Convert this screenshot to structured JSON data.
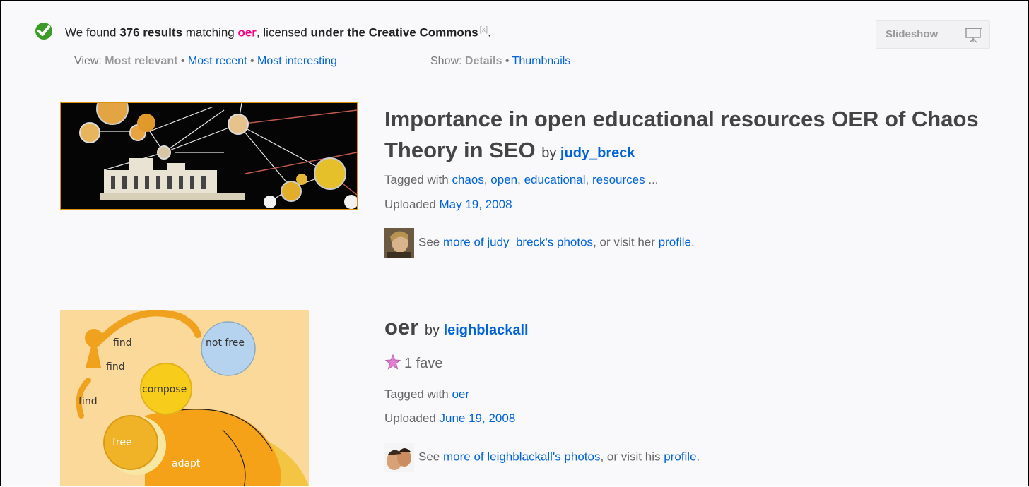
{
  "header": {
    "found_prefix": "We found ",
    "found_count": "376 results",
    "found_mid": " matching ",
    "query": "oer",
    "found_mid2": ", licensed ",
    "license": "under the Creative Commons",
    "close_mark": "[x]",
    "found_end": ".",
    "slideshow_label": "Slideshow"
  },
  "view": {
    "label": "View: ",
    "current": "Most relevant",
    "sep": " • ",
    "options": [
      "Most recent",
      "Most interesting"
    ]
  },
  "show": {
    "label": "Show: ",
    "current": "Details",
    "sep": " • ",
    "option": "Thumbnails"
  },
  "results": [
    {
      "title": "Importance in open educational resources OER of Chaos Theory in SEO",
      "by": "by",
      "author": "judy_breck",
      "tagged_label": "Tagged with ",
      "tags": [
        "chaos",
        "open",
        "educational",
        "resources"
      ],
      "tags_more": " ...",
      "uploaded_label": "Uploaded ",
      "uploaded": "May 19, 2008",
      "see": "See ",
      "more_link": "more of judy_breck's photos",
      "visit": ", or visit her ",
      "profile": "profile",
      "end": "."
    },
    {
      "title": "oer",
      "by": "by",
      "author": "leighblackall",
      "fave_count": "1 fave",
      "tagged_label": "Tagged with ",
      "tags": [
        "oer"
      ],
      "uploaded_label": "Uploaded ",
      "uploaded": "June 19, 2008",
      "see": "See ",
      "more_link": "more of leighblackall's photos",
      "visit": ", or visit his ",
      "profile": "profile",
      "end": ".",
      "image_words": [
        "find",
        "find",
        "find",
        "not free",
        "compose",
        "free",
        "adapt"
      ]
    }
  ],
  "colors": {
    "link": "#0063dc",
    "query": "#ff0084",
    "thumb_border": "#d9930f"
  },
  "icons": [
    "check-icon",
    "slideshow-icon",
    "star-icon"
  ]
}
